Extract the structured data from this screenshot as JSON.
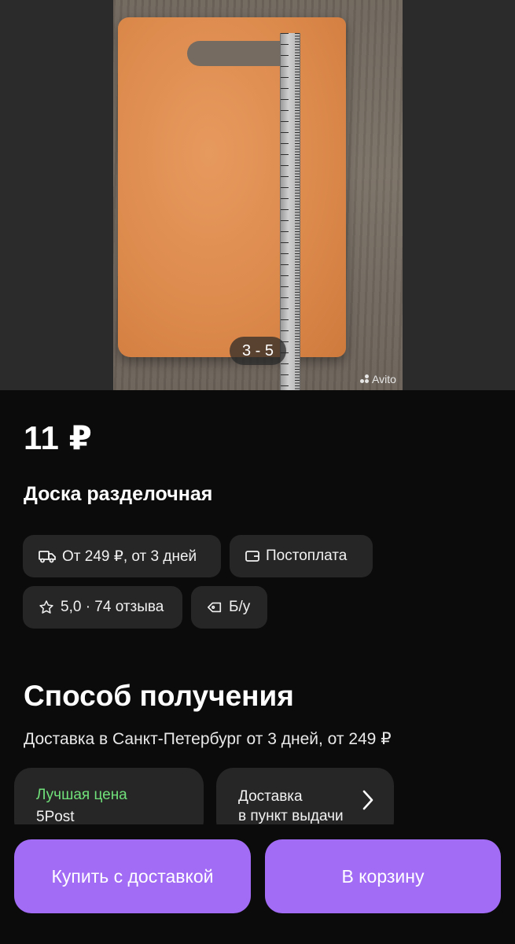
{
  "gallery": {
    "photo_counter": "3 - 5",
    "watermark": "Avito"
  },
  "listing": {
    "price": "11 ₽",
    "title": "Доска разделочная"
  },
  "chips": {
    "delivery": "От 249 ₽, от 3 дней",
    "payment": "Постоплата",
    "rating": "5,0 · 74 отзыва",
    "condition": "Б/у"
  },
  "receiving": {
    "title": "Способ получения",
    "subtitle": "Доставка в Санкт-Петербург от 3 дней, от 249 ₽",
    "options": [
      {
        "label": "Лучшая цена",
        "name": "5Post"
      },
      {
        "label_line1": "Доставка",
        "label_line2": "в пункт выдачи"
      }
    ]
  },
  "actions": {
    "buy": "Купить с доставкой",
    "cart": "В корзину"
  },
  "colors": {
    "accent": "#a26cf5",
    "best_price": "#70e07a",
    "chip_bg": "#262626",
    "background": "#0b0b0b"
  }
}
